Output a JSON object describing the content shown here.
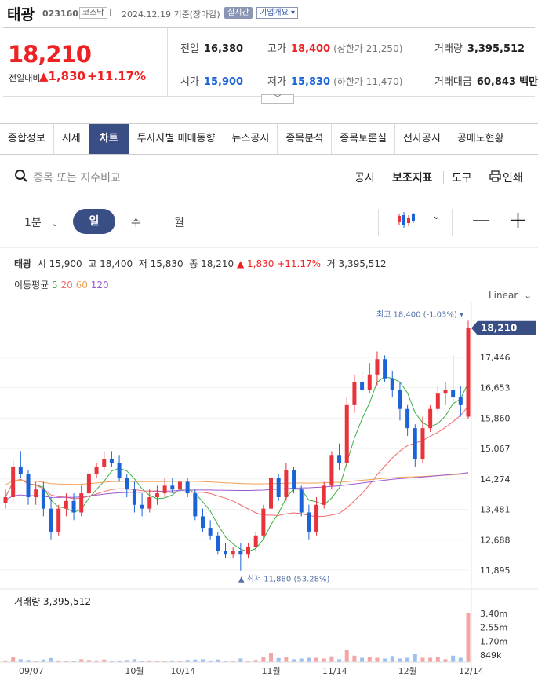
{
  "header": {
    "name": "태광",
    "code": "023160",
    "market": "코스닥",
    "date": "2024.12.19",
    "basis": "기준(장마감)",
    "realtime": "실시간",
    "company": "기업개요"
  },
  "price": {
    "current": "18,210",
    "change_label": "전일대비",
    "change": "1,830",
    "change_pct": "+11.17%"
  },
  "summary": {
    "prev_close": {
      "label": "전일",
      "value": "16,380"
    },
    "high": {
      "label": "고가",
      "value": "18,400",
      "note": "(상한가 21,250)"
    },
    "volume": {
      "label": "거래량",
      "value": "3,395,512"
    },
    "open": {
      "label": "시가",
      "value": "15,900"
    },
    "low": {
      "label": "저가",
      "value": "15,830",
      "note": "(하한가 11,470)"
    },
    "turnover": {
      "label": "거래대금",
      "value": "60,843",
      "unit": "백만"
    }
  },
  "tabs": [
    "종합정보",
    "시세",
    "차트",
    "투자자별 매매동향",
    "뉴스공시",
    "종목분석",
    "종목토론실",
    "전자공시",
    "공매도현황"
  ],
  "active_tab": "차트",
  "search": {
    "placeholder": "종목 또는 지수비교"
  },
  "tools": {
    "disclosure": "공시",
    "indicators": "보조지표",
    "tools": "도구",
    "print": "인쇄"
  },
  "periods": {
    "min": "1분",
    "day": "일",
    "week": "주",
    "month": "월"
  },
  "ohlc": {
    "name": "태광",
    "open_label": "시",
    "open": "15,900",
    "high_label": "고",
    "high": "18,400",
    "low_label": "저",
    "low": "15,830",
    "close_label": "종",
    "close": "18,210",
    "change": "▲ 1,830",
    "pct": "+11.17%",
    "vol_label": "거",
    "volume": "3,395,512"
  },
  "ma": {
    "label": "이동평균",
    "p5": "5",
    "p20": "20",
    "p60": "60",
    "p120": "120"
  },
  "scale_mode": "Linear",
  "colors": {
    "up": "#e8323c",
    "down": "#1a64d8",
    "ma5": "#3cb043",
    "ma20": "#ef6c6c",
    "ma60": "#f0a058",
    "ma120": "#9b59d0",
    "accent": "#3a4e86"
  },
  "chart_data": {
    "type": "candlestick",
    "price_axis": [
      "17,446",
      "16,653",
      "15,860",
      "15,067",
      "14,274",
      "13,481",
      "12,688",
      "11,895"
    ],
    "current_price_tag": "18,210",
    "max_label": "최고 18,400 (-1.03%)",
    "min_label": "최저 11,880 (53.28%)",
    "x_ticks": [
      "09/07",
      "10월",
      "10/14",
      "11월",
      "11/14",
      "12월",
      "12/14"
    ],
    "volume_label": "거래량 3,395,512",
    "volume_axis": [
      "3.40m",
      "2.55m",
      "1.70m",
      "849k"
    ],
    "candles": [
      [
        13650,
        14000,
        13500,
        13800
      ],
      [
        13800,
        14800,
        13700,
        14600
      ],
      [
        14600,
        15000,
        14300,
        14400
      ],
      [
        14400,
        14500,
        13600,
        13800
      ],
      [
        13800,
        14200,
        13600,
        14000
      ],
      [
        14000,
        14200,
        13300,
        13500
      ],
      [
        13500,
        13800,
        12700,
        12900
      ],
      [
        12900,
        13600,
        12800,
        13500
      ],
      [
        13500,
        13900,
        13300,
        13700
      ],
      [
        13700,
        13900,
        13200,
        13400
      ],
      [
        13400,
        14100,
        13300,
        13900
      ],
      [
        13900,
        14500,
        13800,
        14400
      ],
      [
        14400,
        14700,
        14300,
        14600
      ],
      [
        14600,
        15000,
        14500,
        14800
      ],
      [
        14800,
        15000,
        14600,
        14700
      ],
      [
        14700,
        14900,
        14200,
        14300
      ],
      [
        14300,
        14400,
        13800,
        14000
      ],
      [
        14000,
        14200,
        13400,
        13600
      ],
      [
        13600,
        13900,
        13300,
        13500
      ],
      [
        13500,
        14000,
        13400,
        13800
      ],
      [
        13800,
        14100,
        13600,
        13900
      ],
      [
        13900,
        14300,
        13800,
        14100
      ],
      [
        14100,
        14300,
        13900,
        14000
      ],
      [
        14000,
        14300,
        13900,
        14200
      ],
      [
        14200,
        14300,
        13800,
        13900
      ],
      [
        13900,
        14000,
        13200,
        13300
      ],
      [
        13300,
        13500,
        12900,
        13000
      ],
      [
        13000,
        13200,
        12700,
        12800
      ],
      [
        12800,
        12900,
        12300,
        12400
      ],
      [
        12400,
        12600,
        12200,
        12300
      ],
      [
        12300,
        12500,
        12200,
        12400
      ],
      [
        12400,
        12600,
        11880,
        12300
      ],
      [
        12300,
        12600,
        12200,
        12500
      ],
      [
        12500,
        12900,
        12400,
        12800
      ],
      [
        12800,
        13600,
        12700,
        13500
      ],
      [
        13500,
        14500,
        13400,
        14300
      ],
      [
        14300,
        14400,
        13700,
        13800
      ],
      [
        13800,
        14700,
        13700,
        14500
      ],
      [
        14500,
        14600,
        13900,
        14000
      ],
      [
        14000,
        14100,
        13300,
        13400
      ],
      [
        13400,
        13600,
        12700,
        12900
      ],
      [
        12900,
        13800,
        12800,
        13600
      ],
      [
        13600,
        14200,
        13500,
        14100
      ],
      [
        14100,
        15000,
        14000,
        14900
      ],
      [
        14900,
        15200,
        14500,
        14700
      ],
      [
        14700,
        16400,
        14600,
        16200
      ],
      [
        16200,
        17000,
        16000,
        16800
      ],
      [
        16800,
        17100,
        16500,
        16600
      ],
      [
        16600,
        17300,
        16500,
        17000
      ],
      [
        17000,
        17600,
        16700,
        17400
      ],
      [
        17400,
        17500,
        16800,
        16900
      ],
      [
        16900,
        17100,
        16400,
        16600
      ],
      [
        16600,
        16800,
        15800,
        16100
      ],
      [
        16100,
        16200,
        15400,
        15600
      ],
      [
        15600,
        15700,
        14600,
        14800
      ],
      [
        14800,
        15900,
        14700,
        15600
      ],
      [
        15600,
        16200,
        15500,
        16100
      ],
      [
        16100,
        16700,
        16000,
        16500
      ],
      [
        16500,
        16800,
        16200,
        16600
      ],
      [
        16600,
        17500,
        16300,
        16400
      ],
      [
        16400,
        16700,
        15900,
        16200
      ],
      [
        15900,
        18400,
        15830,
        18210
      ]
    ],
    "volumes": [
      0.12,
      0.35,
      0.2,
      0.15,
      0.1,
      0.18,
      0.28,
      0.12,
      0.08,
      0.1,
      0.2,
      0.15,
      0.12,
      0.18,
      0.1,
      0.12,
      0.15,
      0.2,
      0.1,
      0.12,
      0.08,
      0.1,
      0.12,
      0.1,
      0.15,
      0.18,
      0.2,
      0.12,
      0.18,
      0.08,
      0.1,
      0.25,
      0.1,
      0.15,
      0.35,
      0.62,
      0.28,
      0.35,
      0.2,
      0.25,
      0.3,
      0.3,
      0.25,
      0.4,
      0.2,
      0.85,
      0.45,
      0.3,
      0.35,
      0.3,
      0.25,
      0.42,
      0.25,
      0.3,
      0.55,
      0.3,
      0.3,
      0.35,
      0.2,
      0.45,
      0.3,
      3.4
    ]
  }
}
